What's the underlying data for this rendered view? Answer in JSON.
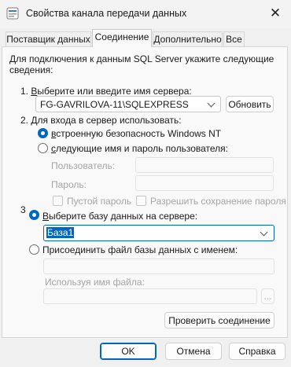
{
  "window": {
    "title": "Свойства канала передачи данных",
    "close_glyph": "✕"
  },
  "tabs": [
    "Поставщик данных",
    "Соединение",
    "Дополнительно",
    "Все"
  ],
  "intro": {
    "line1": "Для подключения к данным SQL Server укажите следующие",
    "line2": "сведения:"
  },
  "step1": {
    "prefix": "1. ",
    "u": "В",
    "rest": "ыберите или введите имя сервера:",
    "server_value": "FG-GAVRILOVA-11\\SQLEXPRESS",
    "refresh_label": "Обновить"
  },
  "step2": {
    "label": "2. Для входа в сервер использовать:",
    "option1_u": "в",
    "option1_rest": "строенную безопасность Windows NT",
    "option2_u": "с",
    "option2_rest": "ледующие имя и пароль пользователя:",
    "user_label": "Пользователь:",
    "password_label": "Пароль:",
    "empty_password": "Пустой пароль",
    "allow_save": "Разрешить сохранение пароля"
  },
  "step3": {
    "label": "3",
    "option1_u": "В",
    "option1_rest": "ыберите базу данных на сервере:",
    "db_value": "База1",
    "option2": "Присоединить файл базы данных с именем:",
    "browse_label": "...",
    "logical_label": "Используя имя файла:"
  },
  "test_button": "Проверить соединение",
  "footer": {
    "ok": "OK",
    "cancel": "Отмена",
    "help": "Справка"
  },
  "colors": {
    "accent": "#0067c0",
    "background": "#f0f0f0"
  }
}
